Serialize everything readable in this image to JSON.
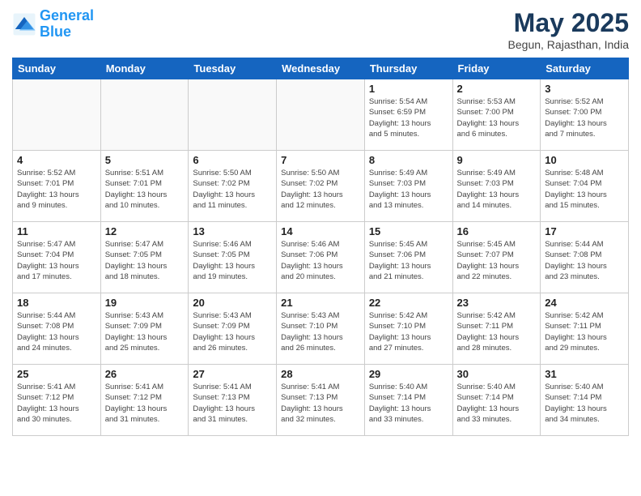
{
  "header": {
    "logo_line1": "General",
    "logo_line2": "Blue",
    "month_title": "May 2025",
    "subtitle": "Begun, Rajasthan, India"
  },
  "weekdays": [
    "Sunday",
    "Monday",
    "Tuesday",
    "Wednesday",
    "Thursday",
    "Friday",
    "Saturday"
  ],
  "weeks": [
    [
      {
        "day": "",
        "info": ""
      },
      {
        "day": "",
        "info": ""
      },
      {
        "day": "",
        "info": ""
      },
      {
        "day": "",
        "info": ""
      },
      {
        "day": "1",
        "info": "Sunrise: 5:54 AM\nSunset: 6:59 PM\nDaylight: 13 hours\nand 5 minutes."
      },
      {
        "day": "2",
        "info": "Sunrise: 5:53 AM\nSunset: 7:00 PM\nDaylight: 13 hours\nand 6 minutes."
      },
      {
        "day": "3",
        "info": "Sunrise: 5:52 AM\nSunset: 7:00 PM\nDaylight: 13 hours\nand 7 minutes."
      }
    ],
    [
      {
        "day": "4",
        "info": "Sunrise: 5:52 AM\nSunset: 7:01 PM\nDaylight: 13 hours\nand 9 minutes."
      },
      {
        "day": "5",
        "info": "Sunrise: 5:51 AM\nSunset: 7:01 PM\nDaylight: 13 hours\nand 10 minutes."
      },
      {
        "day": "6",
        "info": "Sunrise: 5:50 AM\nSunset: 7:02 PM\nDaylight: 13 hours\nand 11 minutes."
      },
      {
        "day": "7",
        "info": "Sunrise: 5:50 AM\nSunset: 7:02 PM\nDaylight: 13 hours\nand 12 minutes."
      },
      {
        "day": "8",
        "info": "Sunrise: 5:49 AM\nSunset: 7:03 PM\nDaylight: 13 hours\nand 13 minutes."
      },
      {
        "day": "9",
        "info": "Sunrise: 5:49 AM\nSunset: 7:03 PM\nDaylight: 13 hours\nand 14 minutes."
      },
      {
        "day": "10",
        "info": "Sunrise: 5:48 AM\nSunset: 7:04 PM\nDaylight: 13 hours\nand 15 minutes."
      }
    ],
    [
      {
        "day": "11",
        "info": "Sunrise: 5:47 AM\nSunset: 7:04 PM\nDaylight: 13 hours\nand 17 minutes."
      },
      {
        "day": "12",
        "info": "Sunrise: 5:47 AM\nSunset: 7:05 PM\nDaylight: 13 hours\nand 18 minutes."
      },
      {
        "day": "13",
        "info": "Sunrise: 5:46 AM\nSunset: 7:05 PM\nDaylight: 13 hours\nand 19 minutes."
      },
      {
        "day": "14",
        "info": "Sunrise: 5:46 AM\nSunset: 7:06 PM\nDaylight: 13 hours\nand 20 minutes."
      },
      {
        "day": "15",
        "info": "Sunrise: 5:45 AM\nSunset: 7:06 PM\nDaylight: 13 hours\nand 21 minutes."
      },
      {
        "day": "16",
        "info": "Sunrise: 5:45 AM\nSunset: 7:07 PM\nDaylight: 13 hours\nand 22 minutes."
      },
      {
        "day": "17",
        "info": "Sunrise: 5:44 AM\nSunset: 7:08 PM\nDaylight: 13 hours\nand 23 minutes."
      }
    ],
    [
      {
        "day": "18",
        "info": "Sunrise: 5:44 AM\nSunset: 7:08 PM\nDaylight: 13 hours\nand 24 minutes."
      },
      {
        "day": "19",
        "info": "Sunrise: 5:43 AM\nSunset: 7:09 PM\nDaylight: 13 hours\nand 25 minutes."
      },
      {
        "day": "20",
        "info": "Sunrise: 5:43 AM\nSunset: 7:09 PM\nDaylight: 13 hours\nand 26 minutes."
      },
      {
        "day": "21",
        "info": "Sunrise: 5:43 AM\nSunset: 7:10 PM\nDaylight: 13 hours\nand 26 minutes."
      },
      {
        "day": "22",
        "info": "Sunrise: 5:42 AM\nSunset: 7:10 PM\nDaylight: 13 hours\nand 27 minutes."
      },
      {
        "day": "23",
        "info": "Sunrise: 5:42 AM\nSunset: 7:11 PM\nDaylight: 13 hours\nand 28 minutes."
      },
      {
        "day": "24",
        "info": "Sunrise: 5:42 AM\nSunset: 7:11 PM\nDaylight: 13 hours\nand 29 minutes."
      }
    ],
    [
      {
        "day": "25",
        "info": "Sunrise: 5:41 AM\nSunset: 7:12 PM\nDaylight: 13 hours\nand 30 minutes."
      },
      {
        "day": "26",
        "info": "Sunrise: 5:41 AM\nSunset: 7:12 PM\nDaylight: 13 hours\nand 31 minutes."
      },
      {
        "day": "27",
        "info": "Sunrise: 5:41 AM\nSunset: 7:13 PM\nDaylight: 13 hours\nand 31 minutes."
      },
      {
        "day": "28",
        "info": "Sunrise: 5:41 AM\nSunset: 7:13 PM\nDaylight: 13 hours\nand 32 minutes."
      },
      {
        "day": "29",
        "info": "Sunrise: 5:40 AM\nSunset: 7:14 PM\nDaylight: 13 hours\nand 33 minutes."
      },
      {
        "day": "30",
        "info": "Sunrise: 5:40 AM\nSunset: 7:14 PM\nDaylight: 13 hours\nand 33 minutes."
      },
      {
        "day": "31",
        "info": "Sunrise: 5:40 AM\nSunset: 7:14 PM\nDaylight: 13 hours\nand 34 minutes."
      }
    ]
  ]
}
